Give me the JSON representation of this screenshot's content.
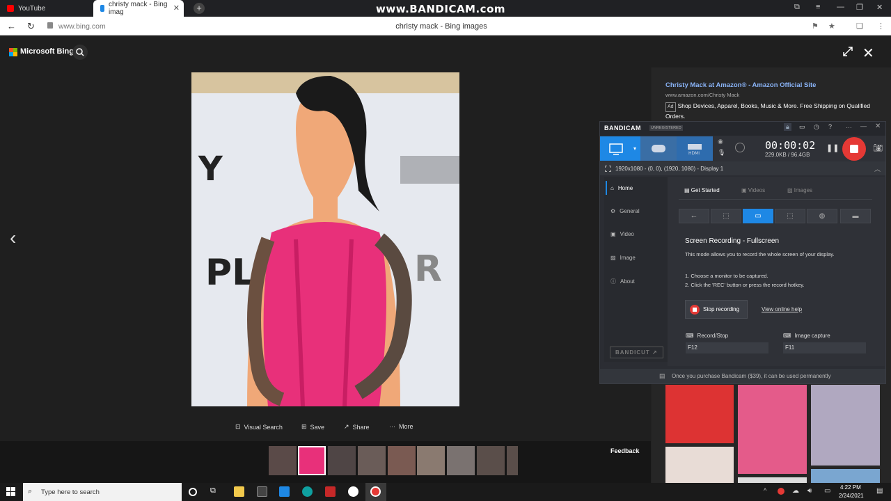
{
  "browser": {
    "tabs": [
      {
        "label": "YouTube",
        "active": false
      },
      {
        "label": "christy mack - Bing imag",
        "active": true
      }
    ],
    "url": "www.bing.com",
    "page_title": "christy mack - Bing images",
    "watermark": "www.BANDICAM.com"
  },
  "bing": {
    "logo_text": "Microsoft Bing",
    "toolbar": {
      "visual_search": "Visual Search",
      "save": "Save",
      "share": "Share",
      "more": "More"
    },
    "feedback": "Feedback",
    "ad": {
      "title": "Christy Mack at Amazon® - Amazon Official Site",
      "url": "www.amazon.com/Christy Mack",
      "badge": "Ad",
      "description": "Shop Devices, Apparel, Books, Music & More. Free Shipping on Qualified Orders."
    }
  },
  "bandicam": {
    "logo": "BANDICAM",
    "unregistered": "UNREGISTERED",
    "timer": "00:00:02",
    "size": "229.0KB / 96.4GB",
    "display": "1920x1080 - (0, 0), (1920, 1080) - Display 1",
    "sidebar": [
      "Home",
      "General",
      "Video",
      "Image",
      "About"
    ],
    "tabs": [
      "Get Started",
      "Videos",
      "Images"
    ],
    "heading": "Screen Recording - Fullscreen",
    "description": "This mode allows you to record the whole screen of your display.",
    "step1": "1. Choose a monitor to be captured.",
    "step2": "2. Click the 'REC' button or press the record hotkey.",
    "stop_recording": "Stop recording",
    "view_help": "View online help",
    "record_stop_label": "Record/Stop",
    "record_stop_key": "F12",
    "image_capture_label": "Image capture",
    "image_capture_key": "F11",
    "bandicut": "BANDICUT",
    "footer": "Once you purchase Bandicam ($39), it can be used permanently"
  },
  "taskbar": {
    "search_placeholder": "Type here to search",
    "time": "4:22 PM",
    "date": "2/24/2021"
  },
  "colors": {
    "bing_blue": "#8ab4f8",
    "bandicam_accent": "#1e88e5",
    "rec_red": "#e53935",
    "tab_youtube": "#ff0000"
  }
}
